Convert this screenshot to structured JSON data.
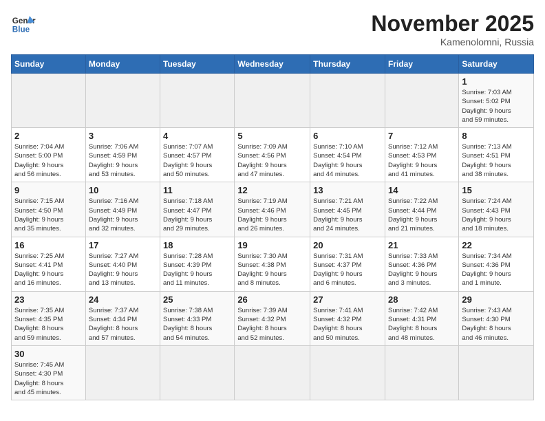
{
  "header": {
    "logo_general": "General",
    "logo_blue": "Blue",
    "month_title": "November 2025",
    "location": "Kamenolomni, Russia"
  },
  "weekdays": [
    "Sunday",
    "Monday",
    "Tuesday",
    "Wednesday",
    "Thursday",
    "Friday",
    "Saturday"
  ],
  "weeks": [
    {
      "days": [
        {
          "num": "",
          "info": ""
        },
        {
          "num": "",
          "info": ""
        },
        {
          "num": "",
          "info": ""
        },
        {
          "num": "",
          "info": ""
        },
        {
          "num": "",
          "info": ""
        },
        {
          "num": "",
          "info": ""
        },
        {
          "num": "1",
          "info": "Sunrise: 7:03 AM\nSunset: 5:02 PM\nDaylight: 9 hours\nand 59 minutes."
        }
      ]
    },
    {
      "days": [
        {
          "num": "2",
          "info": "Sunrise: 7:04 AM\nSunset: 5:00 PM\nDaylight: 9 hours\nand 56 minutes."
        },
        {
          "num": "3",
          "info": "Sunrise: 7:06 AM\nSunset: 4:59 PM\nDaylight: 9 hours\nand 53 minutes."
        },
        {
          "num": "4",
          "info": "Sunrise: 7:07 AM\nSunset: 4:57 PM\nDaylight: 9 hours\nand 50 minutes."
        },
        {
          "num": "5",
          "info": "Sunrise: 7:09 AM\nSunset: 4:56 PM\nDaylight: 9 hours\nand 47 minutes."
        },
        {
          "num": "6",
          "info": "Sunrise: 7:10 AM\nSunset: 4:54 PM\nDaylight: 9 hours\nand 44 minutes."
        },
        {
          "num": "7",
          "info": "Sunrise: 7:12 AM\nSunset: 4:53 PM\nDaylight: 9 hours\nand 41 minutes."
        },
        {
          "num": "8",
          "info": "Sunrise: 7:13 AM\nSunset: 4:51 PM\nDaylight: 9 hours\nand 38 minutes."
        }
      ]
    },
    {
      "days": [
        {
          "num": "9",
          "info": "Sunrise: 7:15 AM\nSunset: 4:50 PM\nDaylight: 9 hours\nand 35 minutes."
        },
        {
          "num": "10",
          "info": "Sunrise: 7:16 AM\nSunset: 4:49 PM\nDaylight: 9 hours\nand 32 minutes."
        },
        {
          "num": "11",
          "info": "Sunrise: 7:18 AM\nSunset: 4:47 PM\nDaylight: 9 hours\nand 29 minutes."
        },
        {
          "num": "12",
          "info": "Sunrise: 7:19 AM\nSunset: 4:46 PM\nDaylight: 9 hours\nand 26 minutes."
        },
        {
          "num": "13",
          "info": "Sunrise: 7:21 AM\nSunset: 4:45 PM\nDaylight: 9 hours\nand 24 minutes."
        },
        {
          "num": "14",
          "info": "Sunrise: 7:22 AM\nSunset: 4:44 PM\nDaylight: 9 hours\nand 21 minutes."
        },
        {
          "num": "15",
          "info": "Sunrise: 7:24 AM\nSunset: 4:43 PM\nDaylight: 9 hours\nand 18 minutes."
        }
      ]
    },
    {
      "days": [
        {
          "num": "16",
          "info": "Sunrise: 7:25 AM\nSunset: 4:41 PM\nDaylight: 9 hours\nand 16 minutes."
        },
        {
          "num": "17",
          "info": "Sunrise: 7:27 AM\nSunset: 4:40 PM\nDaylight: 9 hours\nand 13 minutes."
        },
        {
          "num": "18",
          "info": "Sunrise: 7:28 AM\nSunset: 4:39 PM\nDaylight: 9 hours\nand 11 minutes."
        },
        {
          "num": "19",
          "info": "Sunrise: 7:30 AM\nSunset: 4:38 PM\nDaylight: 9 hours\nand 8 minutes."
        },
        {
          "num": "20",
          "info": "Sunrise: 7:31 AM\nSunset: 4:37 PM\nDaylight: 9 hours\nand 6 minutes."
        },
        {
          "num": "21",
          "info": "Sunrise: 7:33 AM\nSunset: 4:36 PM\nDaylight: 9 hours\nand 3 minutes."
        },
        {
          "num": "22",
          "info": "Sunrise: 7:34 AM\nSunset: 4:36 PM\nDaylight: 9 hours\nand 1 minute."
        }
      ]
    },
    {
      "days": [
        {
          "num": "23",
          "info": "Sunrise: 7:35 AM\nSunset: 4:35 PM\nDaylight: 8 hours\nand 59 minutes."
        },
        {
          "num": "24",
          "info": "Sunrise: 7:37 AM\nSunset: 4:34 PM\nDaylight: 8 hours\nand 57 minutes."
        },
        {
          "num": "25",
          "info": "Sunrise: 7:38 AM\nSunset: 4:33 PM\nDaylight: 8 hours\nand 54 minutes."
        },
        {
          "num": "26",
          "info": "Sunrise: 7:39 AM\nSunset: 4:32 PM\nDaylight: 8 hours\nand 52 minutes."
        },
        {
          "num": "27",
          "info": "Sunrise: 7:41 AM\nSunset: 4:32 PM\nDaylight: 8 hours\nand 50 minutes."
        },
        {
          "num": "28",
          "info": "Sunrise: 7:42 AM\nSunset: 4:31 PM\nDaylight: 8 hours\nand 48 minutes."
        },
        {
          "num": "29",
          "info": "Sunrise: 7:43 AM\nSunset: 4:30 PM\nDaylight: 8 hours\nand 46 minutes."
        }
      ]
    },
    {
      "days": [
        {
          "num": "30",
          "info": "Sunrise: 7:45 AM\nSunset: 4:30 PM\nDaylight: 8 hours\nand 45 minutes."
        },
        {
          "num": "",
          "info": ""
        },
        {
          "num": "",
          "info": ""
        },
        {
          "num": "",
          "info": ""
        },
        {
          "num": "",
          "info": ""
        },
        {
          "num": "",
          "info": ""
        },
        {
          "num": "",
          "info": ""
        }
      ]
    }
  ]
}
